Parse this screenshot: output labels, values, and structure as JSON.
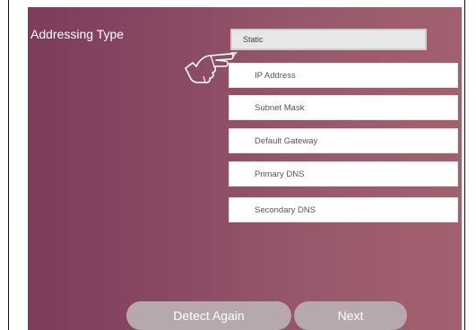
{
  "addressing": {
    "label": "Addressing Type",
    "selected_value": "Static"
  },
  "fields": [
    {
      "label": "IP Address"
    },
    {
      "label": "Subnet Mask"
    },
    {
      "label": "Default Gateway"
    },
    {
      "label": "Primary DNS"
    },
    {
      "label": "Secondary DNS"
    }
  ],
  "buttons": {
    "detect_again": "Detect Again",
    "next": "Next"
  },
  "icons": {
    "pointer": "hand-pointer-icon"
  },
  "colors": {
    "background_start": "#7d3c5b",
    "background_end": "#a3606f",
    "button": "#b5a9ae",
    "field": "#ffffff",
    "selected_field": "#e8e8e8"
  }
}
